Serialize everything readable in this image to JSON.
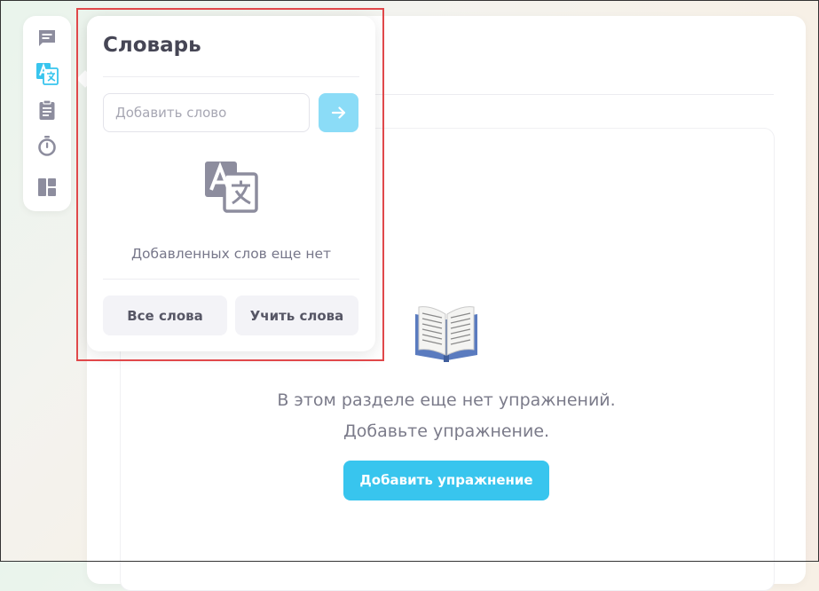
{
  "colors": {
    "accent": "#38c5ee",
    "accent_light": "#8bdcf7",
    "icon_gray": "#8d8d9e",
    "highlight": "#e0484a"
  },
  "toolbar": {
    "items": [
      {
        "icon": "chat-icon",
        "active": false
      },
      {
        "icon": "translate-icon",
        "active": true
      },
      {
        "icon": "clipboard-icon",
        "active": false
      },
      {
        "icon": "timer-icon",
        "active": false
      },
      {
        "icon": "layout-icon",
        "active": false
      }
    ]
  },
  "dictionary": {
    "title": "Словарь",
    "input_placeholder": "Добавить слово",
    "input_value": "",
    "submit_icon": "arrow-right-icon",
    "empty_icon": "translate-icon",
    "empty_text": "Добавленных слов еще нет",
    "all_words_label": "Все слова",
    "learn_words_label": "Учить слова"
  },
  "main": {
    "empty_icon": "open-book-icon",
    "empty_line1": "В этом разделе еще нет упражнений.",
    "empty_line2": "Добавьте упражнение.",
    "add_button_label": "Добавить упражнение"
  }
}
